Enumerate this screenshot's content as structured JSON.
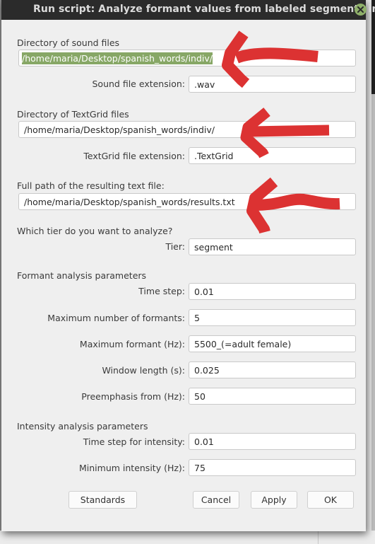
{
  "window": {
    "title": "Run script: Analyze formant values from labeled segments in files",
    "close_icon": "close-icon"
  },
  "form": {
    "sound_dir": {
      "label": "Directory of sound files",
      "value": "/home/maria/Desktop/spanish_words/indiv/",
      "selected": true
    },
    "sound_ext": {
      "label": "Sound file extension:",
      "value": ".wav"
    },
    "textgrid_dir": {
      "label": "Directory of TextGrid files",
      "value": "/home/maria/Desktop/spanish_words/indiv/"
    },
    "textgrid_ext": {
      "label": "TextGrid file extension:",
      "value": ".TextGrid"
    },
    "result_path": {
      "label": "Full path of the resulting text file:",
      "value": "/home/maria/Desktop/spanish_words/results.txt"
    },
    "tier_question": "Which tier do you want to analyze?",
    "tier": {
      "label": "Tier:",
      "value": "segment"
    },
    "formant_section": "Formant analysis parameters",
    "time_step": {
      "label": "Time step:",
      "value": "0.01"
    },
    "max_formants": {
      "label": "Maximum number of formants:",
      "value": "5"
    },
    "max_formant_hz": {
      "label": "Maximum formant (Hz):",
      "value": "5500_(=adult female)"
    },
    "window_length": {
      "label": "Window length (s):",
      "value": "0.025"
    },
    "preemphasis": {
      "label": "Preemphasis from (Hz):",
      "value": "50"
    },
    "intensity_section": "Intensity analysis parameters",
    "intensity_time_step": {
      "label": "Time step for intensity:",
      "value": "0.01"
    },
    "min_intensity": {
      "label": "Minimum intensity (Hz):",
      "value": "75"
    }
  },
  "buttons": {
    "standards": "Standards",
    "cancel": "Cancel",
    "apply": "Apply",
    "ok": "OK"
  },
  "annotations": {
    "arrow_color": "#dc3232",
    "arrows": [
      {
        "points_to": "sound_dir"
      },
      {
        "points_to": "textgrid_dir"
      },
      {
        "points_to": "result_path"
      }
    ]
  }
}
